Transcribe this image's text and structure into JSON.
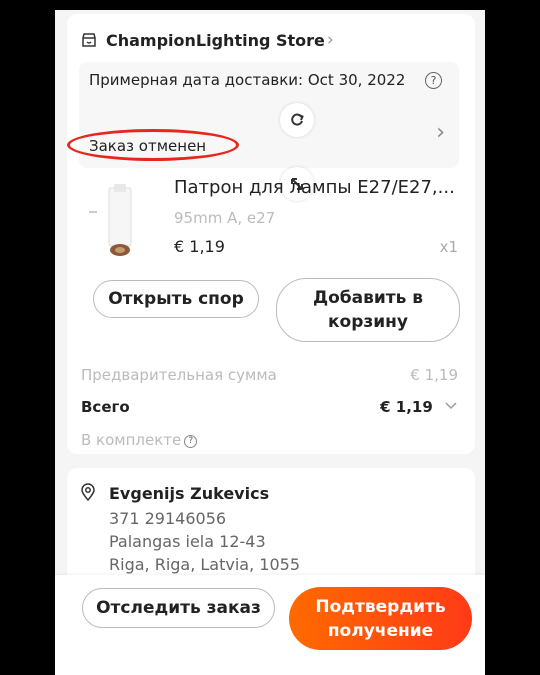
{
  "store": {
    "name": "ChampionLighting Store",
    "chevron": "›",
    "icon": "store-icon"
  },
  "delivery": {
    "label": "Примерная дата доставки: Oct 30, 2022",
    "help": "?"
  },
  "status": {
    "text": "Заказ отменен",
    "annotation_color": "#e8261c"
  },
  "product": {
    "title": "Патрон для лампы E27/E27,...",
    "variant": "95mm A, e27",
    "price": "€ 1,19",
    "quantity": "x1"
  },
  "actions": {
    "dispute": "Открыть спор",
    "add_to_cart": "Добавить в корзину"
  },
  "summary": {
    "subtotal_label": "Предварительная сумма",
    "subtotal_value": "€ 1,19",
    "total_label": "Всего",
    "total_value": "€ 1,19",
    "included_label": "В комплекте"
  },
  "address": {
    "name": "Evgenijs Zukevics",
    "phone": "371 29146056",
    "street": "Palangas iela 12-43",
    "city": "Riga, Riga, Latvia, 1055"
  },
  "bottom": {
    "track": "Отследить заказ",
    "confirm": "Подтвердить получение"
  },
  "colors": {
    "accent": "#ff4d0f"
  }
}
